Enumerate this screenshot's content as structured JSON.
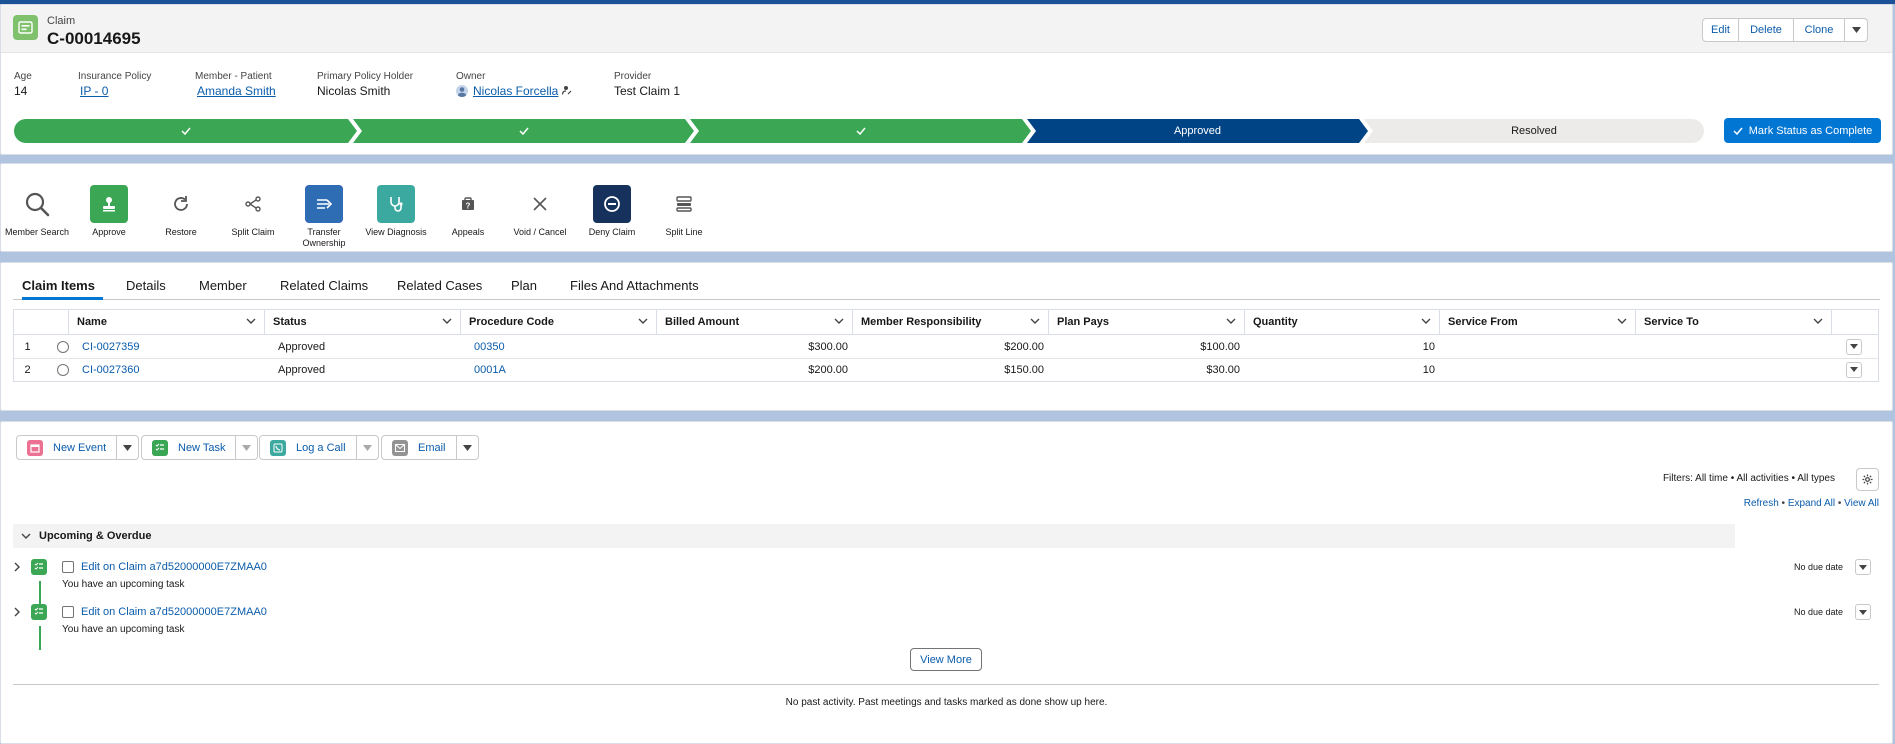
{
  "header": {
    "record_type": "Claim",
    "record_name": "C-00014695",
    "buttons": {
      "edit": "Edit",
      "delete": "Delete",
      "clone": "Clone"
    },
    "fields": [
      {
        "label": "Age",
        "value": "14",
        "link": false
      },
      {
        "label": "Insurance Policy",
        "value": "IP - 0",
        "link": true
      },
      {
        "label": "Member - Patient",
        "value": "Amanda Smith",
        "link": true
      },
      {
        "label": "Primary Policy Holder",
        "value": "Nicolas Smith",
        "link": false
      },
      {
        "label": "Owner",
        "value": "Nicolas Forcella",
        "link": true
      },
      {
        "label": "Provider",
        "value": "Test Claim 1",
        "link": false
      }
    ]
  },
  "path": {
    "steps": [
      {
        "label": "",
        "state": "complete"
      },
      {
        "label": "",
        "state": "complete"
      },
      {
        "label": "",
        "state": "complete"
      },
      {
        "label": "Approved",
        "state": "current"
      },
      {
        "label": "Resolved",
        "state": "incomplete"
      }
    ],
    "mark_complete_label": "Mark Status as Complete",
    "colors": {
      "complete": "#3ba755",
      "current": "#014486",
      "incomplete": "#ecebea"
    }
  },
  "actions": [
    {
      "label": "Member Search",
      "icon": "search-icon"
    },
    {
      "label": "Approve",
      "icon": "stamp-icon"
    },
    {
      "label": "Restore",
      "icon": "refresh-icon"
    },
    {
      "label": "Split Claim",
      "icon": "split-icon"
    },
    {
      "label": "Transfer Ownership",
      "icon": "transfer-icon"
    },
    {
      "label": "View Diagnosis",
      "icon": "stethoscope-icon"
    },
    {
      "label": "Appeals",
      "icon": "appeal-icon"
    },
    {
      "label": "Void / Cancel",
      "icon": "close-icon"
    },
    {
      "label": "Deny Claim",
      "icon": "deny-icon"
    },
    {
      "label": "Split Line",
      "icon": "split-line-icon"
    }
  ],
  "tabs": [
    "Claim Items",
    "Details",
    "Member",
    "Related Claims",
    "Related Cases",
    "Plan",
    "Files And Attachments"
  ],
  "table": {
    "columns": [
      "Name",
      "Status",
      "Procedure Code",
      "Billed Amount",
      "Member Responsibility",
      "Plan Pays",
      "Quantity",
      "Service From",
      "Service To"
    ],
    "rows": [
      {
        "num": "1",
        "name": "CI-0027359",
        "status": "Approved",
        "code": "00350",
        "billed": "$300.00",
        "member_resp": "$200.00",
        "plan_pays": "$100.00",
        "quantity": "10",
        "from": "",
        "to": ""
      },
      {
        "num": "2",
        "name": "CI-0027360",
        "status": "Approved",
        "code": "0001A",
        "billed": "$200.00",
        "member_resp": "$150.00",
        "plan_pays": "$30.00",
        "quantity": "10",
        "from": "",
        "to": ""
      }
    ]
  },
  "activity": {
    "buttons": {
      "new_event": "New Event",
      "new_task": "New Task",
      "log_call": "Log a Call",
      "email": "Email"
    },
    "filters": "Filters: All time • All activities • All types",
    "links": {
      "refresh": "Refresh",
      "expand_all": "Expand All",
      "view_all": "View All"
    },
    "section": "Upcoming & Overdue",
    "tasks": [
      {
        "title": "Edit on Claim a7d52000000E7ZMAA0",
        "subtitle": "You have an upcoming task",
        "due": "No due date"
      },
      {
        "title": "Edit on Claim a7d52000000E7ZMAA0",
        "subtitle": "You have an upcoming task",
        "due": "No due date"
      }
    ],
    "view_more": "View More",
    "no_past": "No past activity. Past meetings and tasks marked as done show up here."
  }
}
